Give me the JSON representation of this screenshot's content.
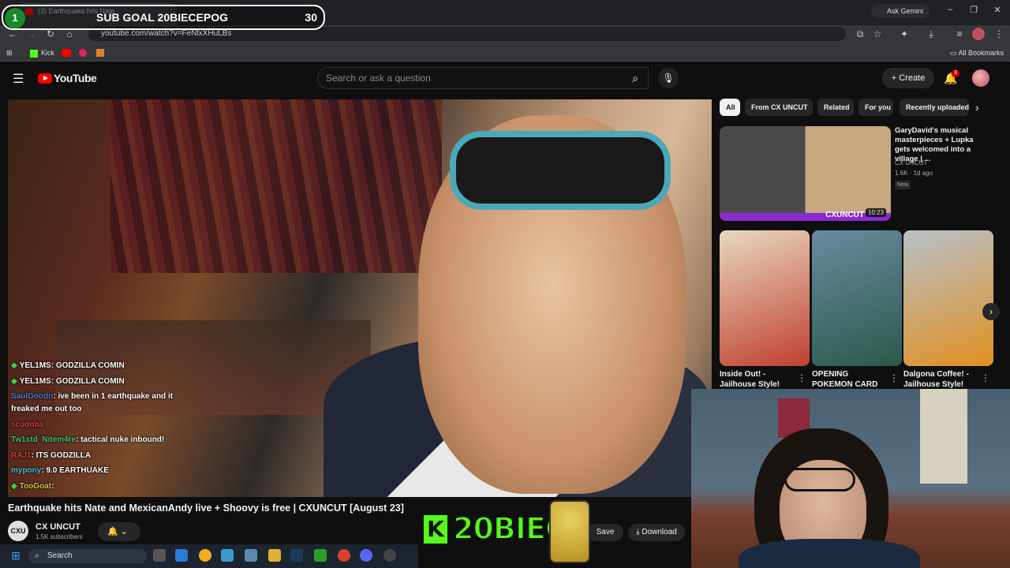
{
  "browser": {
    "tab_title": "(3) Earthquake hits Nate...",
    "url": "youtube.com/watch?v=FeNlxXHuLBs",
    "gemini_label": "Ask Gemini",
    "bookmarks": {
      "kick_label": "Kick",
      "all_bookmarks": "All Bookmarks"
    }
  },
  "overlay": {
    "sub_goal_number": "1",
    "sub_goal_label": "SUB GOAL 20BIECEPOG",
    "sub_goal_count": "30",
    "kick_text": "20BIECE",
    "kick_letter": "K"
  },
  "youtube": {
    "logo_text": "YouTube",
    "search_placeholder": "Search or ask a question",
    "create_label": "Create",
    "notification_count": "3"
  },
  "chat": [
    {
      "user": "YEL1MS",
      "message": ": GODZILLA COMIN",
      "user_color": "#ffffff",
      "badge": true
    },
    {
      "user": "YEL1MS",
      "message": ": GODZILLA COMIN",
      "user_color": "#ffffff",
      "badge": true
    },
    {
      "user": "SaulGoodn",
      "message": ": ive been in 1 earthquake and it",
      "user_color": "#4a7fd8",
      "badge": false
    },
    {
      "user": "",
      "message": "freaked me out too",
      "user_color": "#ffffff",
      "badge": false
    },
    {
      "user": "scudnba",
      "message": "",
      "user_color": "#d04040",
      "badge": false
    },
    {
      "user": "Tw1std_Nitem4re",
      "message": ": tactical nuke inbound!",
      "user_color": "#4cc070",
      "badge": false
    },
    {
      "user": "RAJ1",
      "message": ": ITS GODZILLA",
      "user_color": "#d04040",
      "badge": false
    },
    {
      "user": "mypony",
      "message": ": 9.0 EARTHUAKE",
      "user_color": "#4cc0d0",
      "badge": false
    },
    {
      "user": "TooGoat",
      "message": ":",
      "user_color": "#e0c040",
      "badge": true
    }
  ],
  "video": {
    "title": "Earthquake hits Nate and MexicanAndy live + Shoovy is free | CXUNCUT [August 23]",
    "channel_name": "CX UNCUT",
    "channel_logo": "CXU",
    "subscribers": "1.5K subscribers",
    "save_label": "Save",
    "download_label": "Download"
  },
  "sidebar": {
    "chips": [
      "All",
      "From CX UNCUT",
      "Related",
      "For you",
      "Recently uploaded"
    ],
    "rec1": {
      "title": "GaryDavid's musical masterpieces + Lupka gets welcomed into a village | ...",
      "channel": "CX UNCUT",
      "meta": "1.6K · 1d ago",
      "badge": "New",
      "duration": "10:23",
      "thumb_text": "CXUNCUT"
    },
    "shorts": [
      {
        "title": "Inside Out! - Jailhouse Style!",
        "color1": "#e8d8c0",
        "color2": "#c04030"
      },
      {
        "title": "OPENING POKEMON CARD",
        "color1": "#6a8aa0",
        "color2": "#2a5a4a"
      },
      {
        "title": "Dalgona Coffee! - Jailhouse Style!",
        "color1": "#b8c0c8",
        "color2": "#e09020"
      }
    ]
  },
  "taskbar": {
    "search_label": "Search"
  }
}
